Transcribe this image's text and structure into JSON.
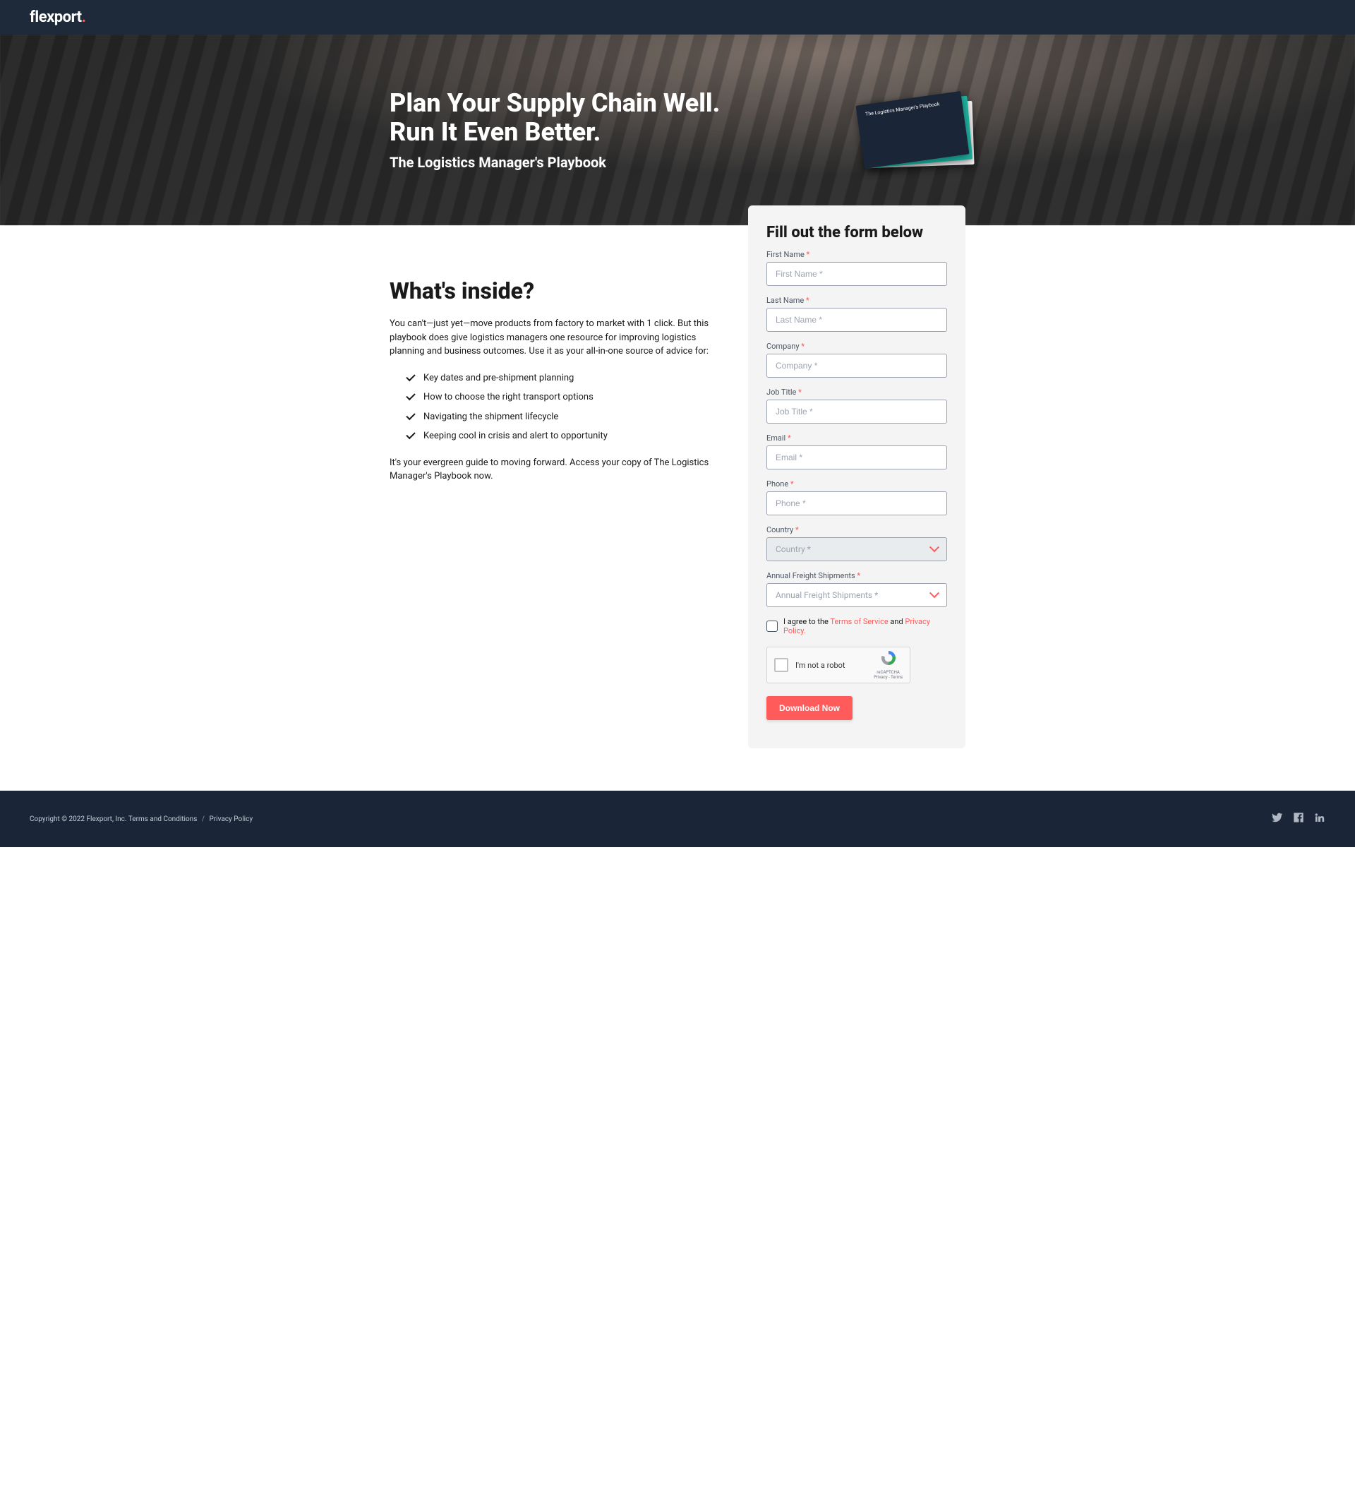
{
  "brand": {
    "name": "flexport",
    "dot": "."
  },
  "hero": {
    "title_line1": "Plan Your Supply Chain Well.",
    "title_line2": "Run It Even Better.",
    "subtitle": "The Logistics Manager's Playbook",
    "card_text": "The Logistics Manager's Playbook"
  },
  "content": {
    "heading": "What's inside?",
    "intro": "You can't—just yet—move products from factory to market with 1 click. But this playbook does give logistics managers one resource for improving logistics planning and business outcomes. Use it as your all-in-one source of advice for:",
    "bullets": [
      "Key dates and pre-shipment planning",
      "How to choose the right transport options",
      "Navigating the shipment lifecycle",
      "Keeping cool in crisis and alert to opportunity"
    ],
    "outro": "It's your evergreen guide to moving forward. Access your copy of The Logistics Manager's Playbook now."
  },
  "form": {
    "heading": "Fill out the form below",
    "fields": {
      "first_name": {
        "label": "First Name",
        "placeholder": "First Name *"
      },
      "last_name": {
        "label": "Last Name",
        "placeholder": "Last Name *"
      },
      "company": {
        "label": "Company",
        "placeholder": "Company *"
      },
      "job_title": {
        "label": "Job Title",
        "placeholder": "Job Title *"
      },
      "email": {
        "label": "Email",
        "placeholder": "Email *"
      },
      "phone": {
        "label": "Phone",
        "placeholder": "Phone *"
      },
      "country": {
        "label": "Country",
        "placeholder": "Country *"
      },
      "shipments": {
        "label": "Annual Freight Shipments",
        "placeholder": "Annual Freight Shipments *"
      }
    },
    "agree": {
      "prefix": "I agree to the ",
      "tos": "Terms of Service",
      "and": " and ",
      "privacy": "Privacy Policy."
    },
    "captcha": {
      "label": "I'm not a robot",
      "brand": "reCAPTCHA",
      "legal": "Privacy - Terms"
    },
    "submit": "Download Now"
  },
  "footer": {
    "copyright_prefix": "Copyright © 2022 Flexport, Inc. ",
    "terms": "Terms and Conditions",
    "sep": "/",
    "privacy": "Privacy Policy"
  }
}
